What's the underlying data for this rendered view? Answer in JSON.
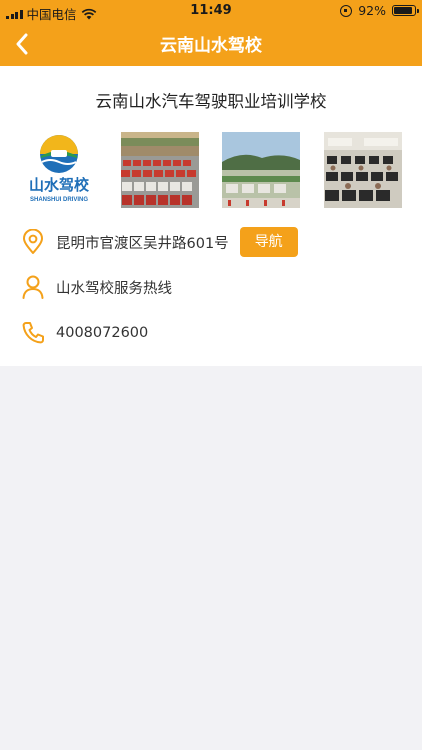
{
  "status_bar": {
    "carrier": "中国电信",
    "time": "11:49",
    "battery_percent": "92%",
    "battery_level": 0.92
  },
  "nav": {
    "title": "云南山水驾校",
    "back_icon": "chevron-left-icon"
  },
  "school": {
    "name": "云南山水汽车驾驶职业培训学校",
    "logo_text": "山水驾校",
    "logo_subtext": "SHANSHUI DRIVING",
    "photos": [
      "car-lot-photo",
      "training-field-photo",
      "classroom-photo"
    ]
  },
  "info": {
    "address": "昆明市官渡区吴井路601号",
    "navigate_label": "导航",
    "contact_name": "山水驾校服务热线",
    "phone": "4008072600"
  },
  "colors": {
    "accent": "#f4a11a",
    "background": "#f2f2f5"
  }
}
